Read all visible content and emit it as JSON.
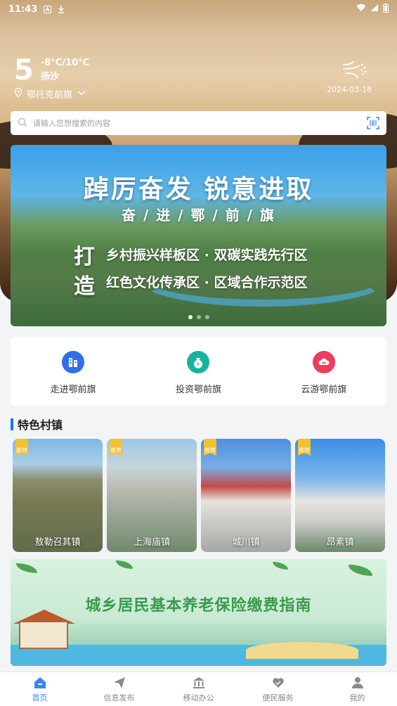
{
  "status_bar": {
    "time": "11:43"
  },
  "weather": {
    "temp": "5",
    "range": "-8°C/10°C",
    "condition": "扬沙",
    "location": "鄂托克前旗",
    "date": "2024-03-18"
  },
  "search": {
    "placeholder": "请输入您想搜索的内容"
  },
  "banner": {
    "title": "踔厉奋发  锐意进取",
    "subtitle": "奋 / 进 / 鄂 / 前 / 旗",
    "char1": "打",
    "char2": "造",
    "line1": "乡村振兴样板区 · 双碳实践先行区",
    "line2": "红色文化传承区 · 区域合作示范区"
  },
  "quick_links": [
    {
      "label": "走进鄂前旗",
      "icon": "building-icon",
      "color": "#2f6fe8"
    },
    {
      "label": "投资鄂前旗",
      "icon": "money-bag-icon",
      "color": "#16b4a0"
    },
    {
      "label": "云游鄂前旗",
      "icon": "cloud-icon",
      "color": "#ec3e5c"
    }
  ],
  "section": {
    "title": "特色村镇"
  },
  "towns": [
    {
      "name": "敖勒召其镇",
      "badge": "推荐"
    },
    {
      "name": "上海庙镇",
      "badge": "推荐"
    },
    {
      "name": "城川镇",
      "badge": "推荐"
    },
    {
      "name": "昂素镇",
      "badge": "推荐"
    }
  ],
  "bottom_banner": {
    "text": "城乡居民基本养老保险缴费指南"
  },
  "tabs": [
    {
      "label": "首页",
      "icon": "home-icon"
    },
    {
      "label": "信息发布",
      "icon": "paper-plane-icon"
    },
    {
      "label": "移动办公",
      "icon": "bank-icon"
    },
    {
      "label": "便民服务",
      "icon": "heart-hand-icon"
    },
    {
      "label": "我的",
      "icon": "user-icon"
    }
  ],
  "colors": {
    "accent": "#3b82f6",
    "section_bar": "#1e6fff"
  }
}
